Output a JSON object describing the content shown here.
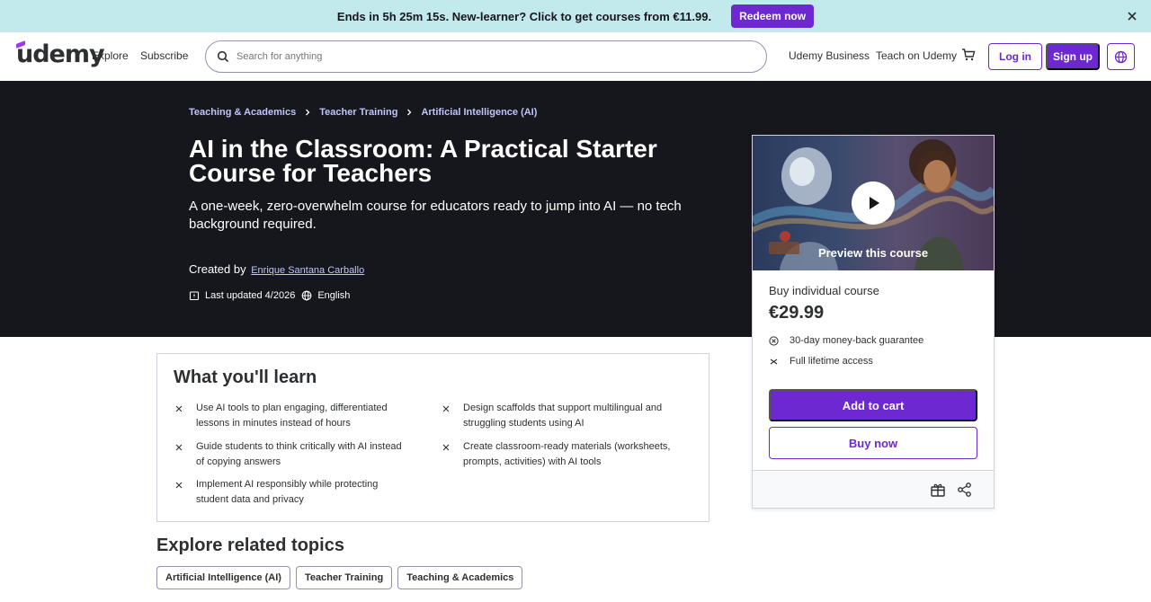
{
  "promo": {
    "text": "Ends in 5h 25m 15s. New-learner? Click to get courses from €11.99.",
    "button": "Redeem now"
  },
  "header": {
    "logo": "udemy",
    "explore": "Explore",
    "subscribe": "Subscribe",
    "search_placeholder": "Search for anything",
    "business": "Udemy Business",
    "teach": "Teach on Udemy",
    "login": "Log in",
    "signup": "Sign up"
  },
  "breadcrumbs": [
    "Teaching & Academics",
    "Teacher Training",
    "Artificial Intelligence (AI)"
  ],
  "course": {
    "title": "AI in the Classroom: A Practical Starter Course for Teachers",
    "subtitle": "A one-week, zero-overwhelm course for educators ready to jump into AI — no tech background required.",
    "created_by_label": "Created by",
    "author": "Enrique Santana Carballo",
    "last_updated": "Last updated 4/2026",
    "language": "English"
  },
  "card": {
    "preview_label": "Preview this course",
    "buy_label": "Buy individual course",
    "price": "€29.99",
    "features": [
      "30-day money-back guarantee",
      "Full lifetime access"
    ],
    "add_to_cart": "Add to cart",
    "buy_now": "Buy now"
  },
  "learn": {
    "title": "What you'll learn",
    "items": [
      "Use AI tools to plan engaging, differentiated lessons in minutes instead of hours",
      "Design scaffolds that support multilingual and struggling students using AI",
      "Guide students to think critically with AI instead of copying answers",
      "Create classroom-ready materials (worksheets, prompts, activities) with AI tools",
      "Implement AI responsibly while protecting student data and privacy"
    ]
  },
  "related": {
    "title": "Explore related topics",
    "topics": [
      "Artificial Intelligence (AI)",
      "Teacher Training",
      "Teaching & Academics"
    ]
  },
  "colors": {
    "accent": "#6d28d2",
    "promo_bg": "#c2e9eb",
    "hero_bg": "#16161d",
    "link_on_dark": "#c0c4fc"
  }
}
